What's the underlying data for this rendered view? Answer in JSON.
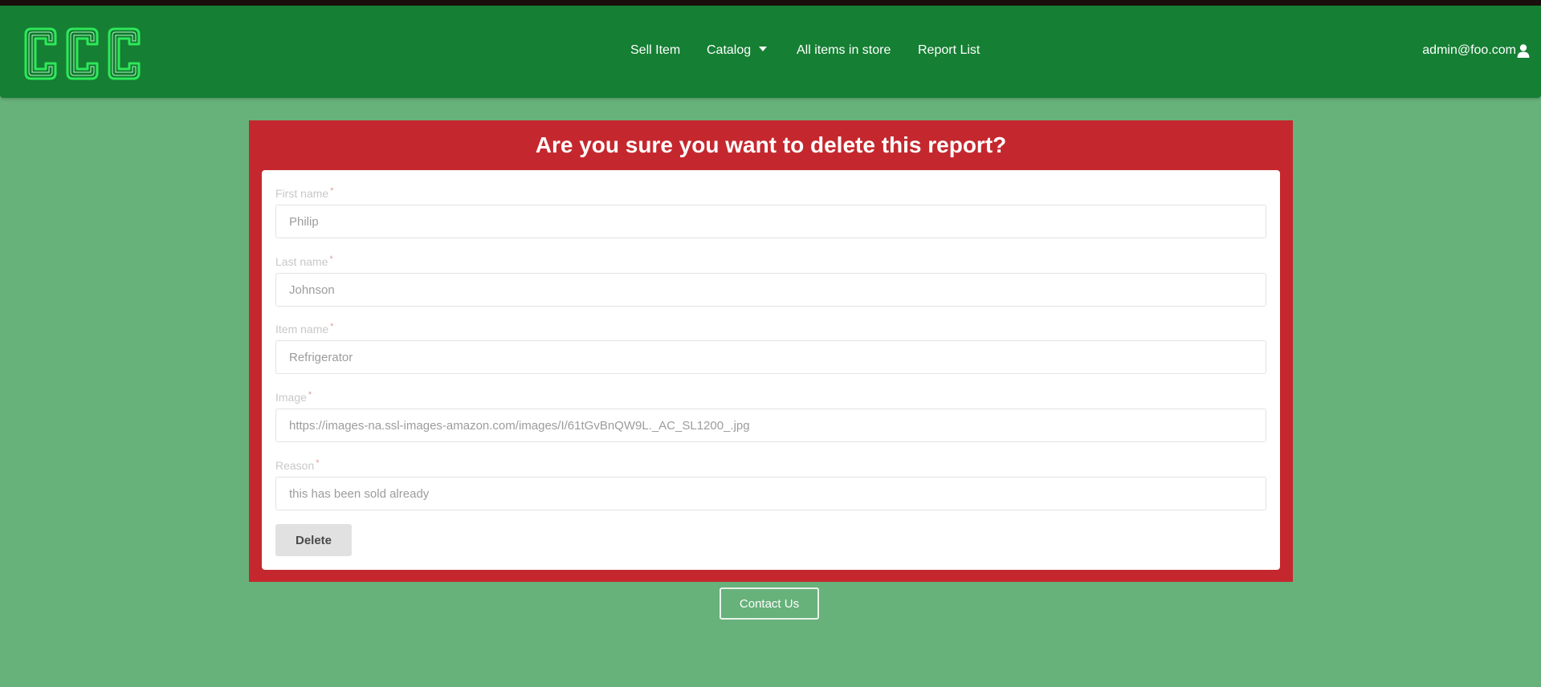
{
  "header": {
    "logo_text": "CCC",
    "nav": {
      "sell_item": "Sell Item",
      "catalog": "Catalog",
      "all_items": "All items in store",
      "report_list": "Report List"
    },
    "user_email": "admin@foo.com",
    "user_icon": "user-icon"
  },
  "dialog": {
    "title": "Are you sure you want to delete this report?",
    "fields": {
      "first_name": {
        "label": "First name",
        "value": "Philip"
      },
      "last_name": {
        "label": "Last name",
        "value": "Johnson"
      },
      "item_name": {
        "label": "Item name",
        "value": "Refrigerator"
      },
      "image": {
        "label": "Image",
        "value": "https://images-na.ssl-images-amazon.com/images/I/61tGvBnQW9L._AC_SL1200_.jpg"
      },
      "reason": {
        "label": "Reason",
        "value": "this has been sold already"
      }
    },
    "required_marker": "*",
    "delete_label": "Delete"
  },
  "footer": {
    "contact_label": "Contact Us"
  },
  "colors": {
    "page_bg": "#67b17a",
    "navbar_bg": "#157f33",
    "panel_bg": "#c4282e",
    "logo_green": "#2ee85a"
  }
}
